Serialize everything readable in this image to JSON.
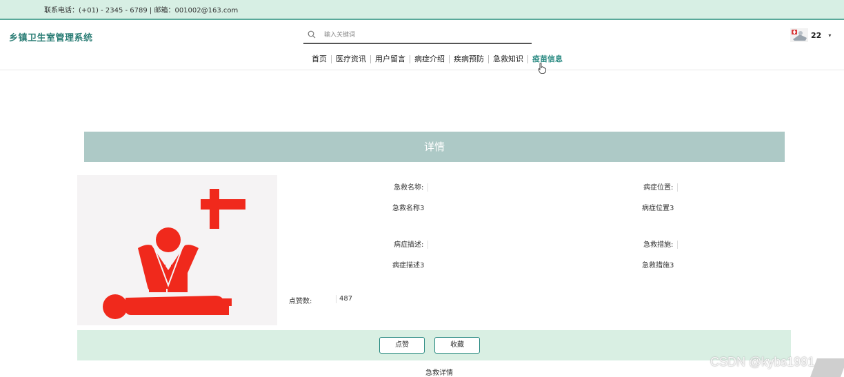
{
  "topbar": {
    "contact": "联系电话：(+01) - 2345 - 6789 | 邮箱：001002@163.com"
  },
  "header": {
    "brand": "乡镇卫生室管理系统",
    "search_placeholder": "输入关键词",
    "user_name": "22",
    "caret": "▾"
  },
  "nav": {
    "items": [
      "首页",
      "医疗资讯",
      "用户留言",
      "病症介绍",
      "疾病预防",
      "急救知识",
      "疫苗信息"
    ],
    "active_index": 6
  },
  "detail": {
    "heading": "详情",
    "fields": [
      {
        "label": "急救名称:",
        "value": "急救名称3"
      },
      {
        "label": "病症位置:",
        "value": "病症位置3"
      },
      {
        "label": "病症描述:",
        "value": "病症描述3"
      },
      {
        "label": "急救措施:",
        "value": "急救措施3"
      }
    ],
    "likes_label": "点赞数:",
    "likes_value": "487"
  },
  "actions": {
    "like": "点赞",
    "favorite": "收藏"
  },
  "footer": {
    "section_title": "急救详情"
  },
  "watermark": "CSDN @kybs1991",
  "colors": {
    "accent": "#2a8a82",
    "topbar": "#d7efe4",
    "heading_bg": "#adc9c6",
    "cpr_red": "#f0291c"
  },
  "icons": {
    "search": "search-icon",
    "avatar": "user-avatar-icon",
    "cross": "red-cross-icon",
    "cpr": "cpr-illustration"
  }
}
